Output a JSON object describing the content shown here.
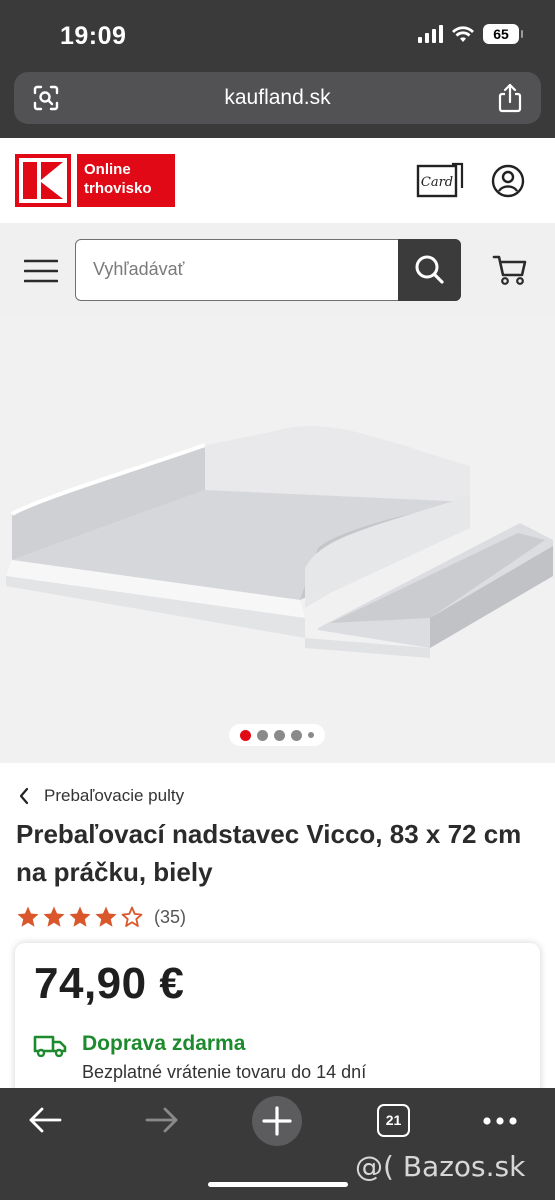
{
  "status_bar": {
    "time": "19:09",
    "battery": "65"
  },
  "browser": {
    "url": "kaufland.sk",
    "tab_count": "21"
  },
  "header": {
    "logo_text": "Online trhovisko",
    "card_icon_text": "Card",
    "brand_color": "#e10915"
  },
  "search": {
    "placeholder": "Vyhľadávať"
  },
  "gallery": {
    "slide_count": 5,
    "active_slide": 1
  },
  "product": {
    "breadcrumb": "Prebaľovacie pulty",
    "title": "Prebaľovací nadstavec Vicco, 83 x 72 cm na práčku, biely",
    "rating": 4.5,
    "rating_count": "(35)",
    "price": "74,90 €",
    "shipping": "Doprava zdarma",
    "returns": "Bezplatné vrátenie tovaru do 14 dní",
    "shipping_color": "#1e8a2e",
    "star_color": "#d9572b"
  },
  "watermark": "@( Bazos.sk"
}
